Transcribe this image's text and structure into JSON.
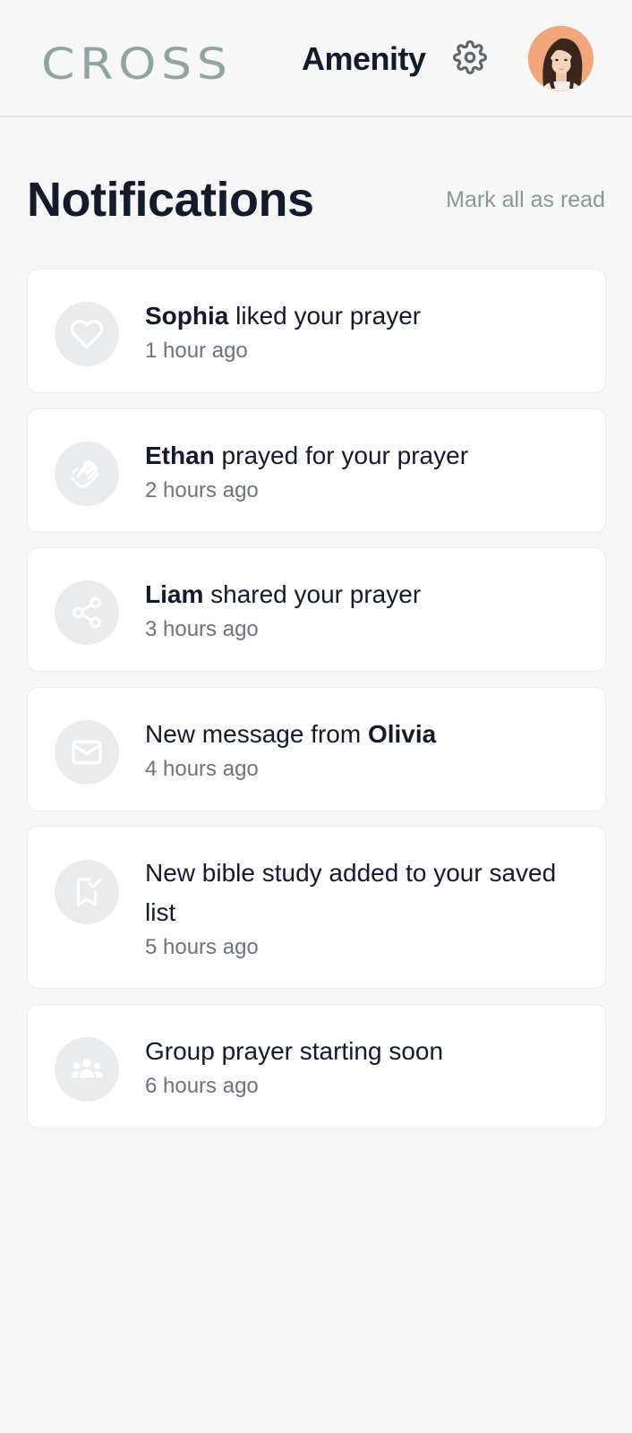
{
  "header": {
    "logo_primary": "CROSS",
    "logo_secondary": "Amenity",
    "settings_icon": "gear-icon",
    "avatar_icon": "user-avatar"
  },
  "page": {
    "title": "Notifications",
    "mark_all_read": "Mark all as read"
  },
  "notifications": [
    {
      "icon": "heart-icon",
      "pre": "",
      "name": "Sophia",
      "post": " liked your prayer",
      "time": "1 hour ago"
    },
    {
      "icon": "praying-hands-icon",
      "pre": "",
      "name": "Ethan",
      "post": " prayed for your prayer",
      "time": "2 hours ago"
    },
    {
      "icon": "share-icon",
      "pre": "",
      "name": "Liam",
      "post": " shared your prayer",
      "time": "3 hours ago"
    },
    {
      "icon": "envelope-icon",
      "pre": "New message from ",
      "name": "Olivia",
      "post": "",
      "time": "4 hours ago"
    },
    {
      "icon": "bookmark-check-icon",
      "pre": "New bible study added to your saved list",
      "name": "",
      "post": "",
      "time": "5 hours ago"
    },
    {
      "icon": "group-icon",
      "pre": "Group prayer starting soon",
      "name": "",
      "post": "",
      "time": "6 hours ago"
    }
  ],
  "colors": {
    "background": "#f7f7f8",
    "logo_cross": "#8fa4a3",
    "title_text": "#131a2b",
    "muted_text": "#6b7280",
    "link_text": "#86999a",
    "icon_circle": "#e9ebec"
  }
}
